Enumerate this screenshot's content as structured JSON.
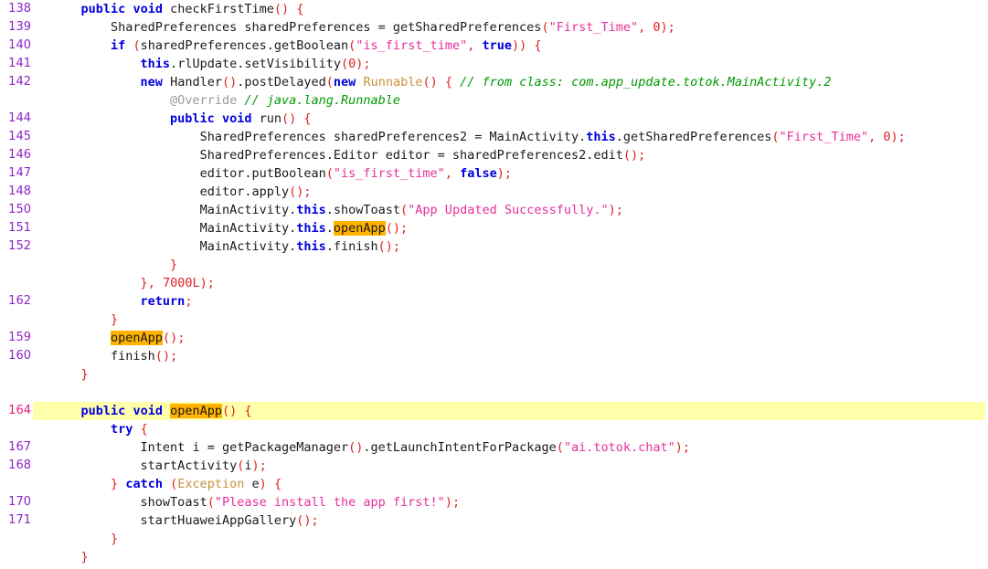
{
  "viewer": {
    "name": "decompiled-java-source-viewer",
    "language": "java",
    "class_reference": "com.app_update.totok.MainActivity",
    "search_term": "openApp",
    "current_line": "164"
  },
  "colors": {
    "background": "#ffffff",
    "line_number": "#8e24c6",
    "line_number_current": "#e5187a",
    "keyword": "#0000e0",
    "string": "#e5309b",
    "punctuation": "#e02020",
    "type": "#c8913a",
    "comment": "#009a00",
    "annotation": "#9a9a9a",
    "search_highlight": "#ffb300",
    "current_line_highlight": "#ffffaa",
    "text": "#1a1a1a"
  },
  "lines": [
    {
      "number": "138",
      "highlighted": false,
      "indent": 4,
      "tokens": [
        {
          "t": "public",
          "c": "kw"
        },
        {
          "t": " ",
          "c": "plain"
        },
        {
          "t": "void",
          "c": "kw"
        },
        {
          "t": " checkFirstTime",
          "c": "plain"
        },
        {
          "t": "()",
          "c": "punc"
        },
        {
          "t": " ",
          "c": "plain"
        },
        {
          "t": "{",
          "c": "punc"
        }
      ]
    },
    {
      "number": "139",
      "highlighted": false,
      "indent": 8,
      "tokens": [
        {
          "t": "SharedPreferences sharedPreferences = getSharedPreferences",
          "c": "plain"
        },
        {
          "t": "(",
          "c": "punc"
        },
        {
          "t": "\"First_Time\"",
          "c": "str"
        },
        {
          "t": ", ",
          "c": "punc"
        },
        {
          "t": "0",
          "c": "num"
        },
        {
          "t": ");",
          "c": "punc"
        }
      ]
    },
    {
      "number": "140",
      "highlighted": false,
      "indent": 8,
      "tokens": [
        {
          "t": "if",
          "c": "kw"
        },
        {
          "t": " ",
          "c": "plain"
        },
        {
          "t": "(",
          "c": "punc"
        },
        {
          "t": "sharedPreferences.getBoolean",
          "c": "plain"
        },
        {
          "t": "(",
          "c": "punc"
        },
        {
          "t": "\"is_first_time\"",
          "c": "str"
        },
        {
          "t": ", ",
          "c": "punc"
        },
        {
          "t": "true",
          "c": "kw"
        },
        {
          "t": "))",
          "c": "punc"
        },
        {
          "t": " ",
          "c": "plain"
        },
        {
          "t": "{",
          "c": "punc"
        }
      ]
    },
    {
      "number": "141",
      "highlighted": false,
      "indent": 12,
      "tokens": [
        {
          "t": "this",
          "c": "kw"
        },
        {
          "t": ".rlUpdate.setVisibility",
          "c": "plain"
        },
        {
          "t": "(",
          "c": "punc"
        },
        {
          "t": "0",
          "c": "num"
        },
        {
          "t": ");",
          "c": "punc"
        }
      ]
    },
    {
      "number": "142",
      "highlighted": false,
      "indent": 12,
      "tokens": [
        {
          "t": "new",
          "c": "kw"
        },
        {
          "t": " Handler",
          "c": "plain"
        },
        {
          "t": "()",
          "c": "punc"
        },
        {
          "t": ".postDelayed",
          "c": "plain"
        },
        {
          "t": "(",
          "c": "punc"
        },
        {
          "t": "new",
          "c": "kw"
        },
        {
          "t": " ",
          "c": "plain"
        },
        {
          "t": "Runnable",
          "c": "type"
        },
        {
          "t": "()",
          "c": "punc"
        },
        {
          "t": " ",
          "c": "plain"
        },
        {
          "t": "{",
          "c": "punc"
        },
        {
          "t": " ",
          "c": "plain"
        },
        {
          "t": "// from class: com.app_update.totok.MainActivity.2",
          "c": "cmt"
        }
      ]
    },
    {
      "number": "",
      "highlighted": false,
      "indent": 16,
      "tokens": [
        {
          "t": "@Override",
          "c": "anno"
        },
        {
          "t": " ",
          "c": "plain"
        },
        {
          "t": "// java.lang.Runnable",
          "c": "cmt"
        }
      ]
    },
    {
      "number": "144",
      "highlighted": false,
      "indent": 16,
      "tokens": [
        {
          "t": "public",
          "c": "kw"
        },
        {
          "t": " ",
          "c": "plain"
        },
        {
          "t": "void",
          "c": "kw"
        },
        {
          "t": " run",
          "c": "plain"
        },
        {
          "t": "()",
          "c": "punc"
        },
        {
          "t": " ",
          "c": "plain"
        },
        {
          "t": "{",
          "c": "punc"
        }
      ]
    },
    {
      "number": "145",
      "highlighted": false,
      "indent": 20,
      "tokens": [
        {
          "t": "SharedPreferences sharedPreferences2 = MainActivity.",
          "c": "plain"
        },
        {
          "t": "this",
          "c": "kw"
        },
        {
          "t": ".getSharedPreferences",
          "c": "plain"
        },
        {
          "t": "(",
          "c": "punc"
        },
        {
          "t": "\"First_Time\"",
          "c": "str"
        },
        {
          "t": ", ",
          "c": "punc"
        },
        {
          "t": "0",
          "c": "num"
        },
        {
          "t": ");",
          "c": "punc"
        }
      ]
    },
    {
      "number": "146",
      "highlighted": false,
      "indent": 20,
      "tokens": [
        {
          "t": "SharedPreferences.Editor editor = sharedPreferences2.edit",
          "c": "plain"
        },
        {
          "t": "();",
          "c": "punc"
        }
      ]
    },
    {
      "number": "147",
      "highlighted": false,
      "indent": 20,
      "tokens": [
        {
          "t": "editor.putBoolean",
          "c": "plain"
        },
        {
          "t": "(",
          "c": "punc"
        },
        {
          "t": "\"is_first_time\"",
          "c": "str"
        },
        {
          "t": ", ",
          "c": "punc"
        },
        {
          "t": "false",
          "c": "kw"
        },
        {
          "t": ");",
          "c": "punc"
        }
      ]
    },
    {
      "number": "148",
      "highlighted": false,
      "indent": 20,
      "tokens": [
        {
          "t": "editor.apply",
          "c": "plain"
        },
        {
          "t": "();",
          "c": "punc"
        }
      ]
    },
    {
      "number": "150",
      "highlighted": false,
      "indent": 20,
      "tokens": [
        {
          "t": "MainActivity.",
          "c": "plain"
        },
        {
          "t": "this",
          "c": "kw"
        },
        {
          "t": ".showToast",
          "c": "plain"
        },
        {
          "t": "(",
          "c": "punc"
        },
        {
          "t": "\"App Updated Successfully.\"",
          "c": "str"
        },
        {
          "t": ");",
          "c": "punc"
        }
      ]
    },
    {
      "number": "151",
      "highlighted": false,
      "indent": 20,
      "tokens": [
        {
          "t": "MainActivity.",
          "c": "plain"
        },
        {
          "t": "this",
          "c": "kw"
        },
        {
          "t": ".",
          "c": "plain"
        },
        {
          "t": "openApp",
          "c": "hl"
        },
        {
          "t": "();",
          "c": "punc"
        }
      ]
    },
    {
      "number": "152",
      "highlighted": false,
      "indent": 20,
      "tokens": [
        {
          "t": "MainActivity.",
          "c": "plain"
        },
        {
          "t": "this",
          "c": "kw"
        },
        {
          "t": ".finish",
          "c": "plain"
        },
        {
          "t": "();",
          "c": "punc"
        }
      ]
    },
    {
      "number": "",
      "highlighted": false,
      "indent": 16,
      "tokens": [
        {
          "t": "}",
          "c": "punc"
        }
      ]
    },
    {
      "number": "",
      "highlighted": false,
      "indent": 12,
      "tokens": [
        {
          "t": "}",
          "c": "punc"
        },
        {
          "t": ", ",
          "c": "punc"
        },
        {
          "t": "7000L",
          "c": "num"
        },
        {
          "t": ");",
          "c": "punc"
        }
      ]
    },
    {
      "number": "162",
      "highlighted": false,
      "indent": 12,
      "tokens": [
        {
          "t": "return",
          "c": "kw"
        },
        {
          "t": ";",
          "c": "punc"
        }
      ]
    },
    {
      "number": "",
      "highlighted": false,
      "indent": 8,
      "tokens": [
        {
          "t": "}",
          "c": "punc"
        }
      ]
    },
    {
      "number": "159",
      "highlighted": false,
      "indent": 8,
      "tokens": [
        {
          "t": "openApp",
          "c": "hl"
        },
        {
          "t": "();",
          "c": "punc"
        }
      ]
    },
    {
      "number": "160",
      "highlighted": false,
      "indent": 8,
      "tokens": [
        {
          "t": "finish",
          "c": "plain"
        },
        {
          "t": "();",
          "c": "punc"
        }
      ]
    },
    {
      "number": "",
      "highlighted": false,
      "indent": 4,
      "tokens": [
        {
          "t": "}",
          "c": "punc"
        }
      ]
    },
    {
      "number": "",
      "highlighted": false,
      "indent": 0,
      "tokens": []
    },
    {
      "number": "164",
      "highlighted": true,
      "indent": 4,
      "tokens": [
        {
          "t": "public",
          "c": "kw"
        },
        {
          "t": " ",
          "c": "plain"
        },
        {
          "t": "void",
          "c": "kw"
        },
        {
          "t": " ",
          "c": "plain"
        },
        {
          "t": "openApp",
          "c": "hl"
        },
        {
          "t": "()",
          "c": "punc"
        },
        {
          "t": " ",
          "c": "plain"
        },
        {
          "t": "{",
          "c": "punc"
        }
      ]
    },
    {
      "number": "",
      "highlighted": false,
      "indent": 8,
      "tokens": [
        {
          "t": "try",
          "c": "kw"
        },
        {
          "t": " ",
          "c": "plain"
        },
        {
          "t": "{",
          "c": "punc"
        }
      ]
    },
    {
      "number": "167",
      "highlighted": false,
      "indent": 12,
      "tokens": [
        {
          "t": "Intent i = getPackageManager",
          "c": "plain"
        },
        {
          "t": "()",
          "c": "punc"
        },
        {
          "t": ".getLaunchIntentForPackage",
          "c": "plain"
        },
        {
          "t": "(",
          "c": "punc"
        },
        {
          "t": "\"ai.totok.chat\"",
          "c": "str"
        },
        {
          "t": ");",
          "c": "punc"
        }
      ]
    },
    {
      "number": "168",
      "highlighted": false,
      "indent": 12,
      "tokens": [
        {
          "t": "startActivity",
          "c": "plain"
        },
        {
          "t": "(",
          "c": "punc"
        },
        {
          "t": "i",
          "c": "plain"
        },
        {
          "t": ");",
          "c": "punc"
        }
      ]
    },
    {
      "number": "",
      "highlighted": false,
      "indent": 8,
      "tokens": [
        {
          "t": "}",
          "c": "punc"
        },
        {
          "t": " ",
          "c": "plain"
        },
        {
          "t": "catch",
          "c": "kw"
        },
        {
          "t": " ",
          "c": "plain"
        },
        {
          "t": "(",
          "c": "punc"
        },
        {
          "t": "Exception",
          "c": "type"
        },
        {
          "t": " e",
          "c": "plain"
        },
        {
          "t": ")",
          "c": "punc"
        },
        {
          "t": " ",
          "c": "plain"
        },
        {
          "t": "{",
          "c": "punc"
        }
      ]
    },
    {
      "number": "170",
      "highlighted": false,
      "indent": 12,
      "tokens": [
        {
          "t": "showToast",
          "c": "plain"
        },
        {
          "t": "(",
          "c": "punc"
        },
        {
          "t": "\"Please install the app first!\"",
          "c": "str"
        },
        {
          "t": ");",
          "c": "punc"
        }
      ]
    },
    {
      "number": "171",
      "highlighted": false,
      "indent": 12,
      "tokens": [
        {
          "t": "startHuaweiAppGallery",
          "c": "plain"
        },
        {
          "t": "();",
          "c": "punc"
        }
      ]
    },
    {
      "number": "",
      "highlighted": false,
      "indent": 8,
      "tokens": [
        {
          "t": "}",
          "c": "punc"
        }
      ]
    },
    {
      "number": "",
      "highlighted": false,
      "indent": 4,
      "tokens": [
        {
          "t": "}",
          "c": "punc"
        }
      ]
    }
  ]
}
